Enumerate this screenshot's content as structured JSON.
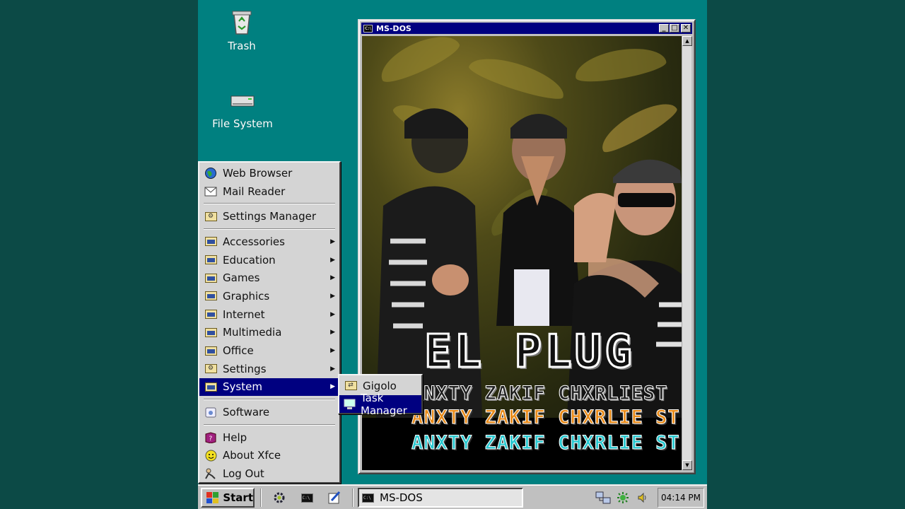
{
  "desktop": {
    "icons": [
      {
        "label": "Trash",
        "icon": "recycle-bin-icon"
      },
      {
        "label": "File System",
        "icon": "drive-icon"
      }
    ]
  },
  "window": {
    "title": "MS-DOS",
    "icon": "cmd-icon",
    "buttons": {
      "minimize": "_",
      "maximize": "□",
      "close": "✕"
    }
  },
  "artwork": {
    "title": "EL PLUG",
    "artists_lines": [
      "ANXTY ZAKIF CHXRLIEST",
      "ANXTY ZAKIF CHXRLIE ST",
      "ANXTY ZAKIF CHXRLIE ST"
    ]
  },
  "start_menu": {
    "items": [
      {
        "label": "Web Browser",
        "icon": "globe-icon"
      },
      {
        "label": "Mail Reader",
        "icon": "envelope-icon"
      },
      {
        "label": "Settings Manager",
        "icon": "settings-folder-icon"
      },
      {
        "label": "Accessories",
        "icon": "folder-icon"
      },
      {
        "label": "Education",
        "icon": "folder-icon"
      },
      {
        "label": "Games",
        "icon": "folder-icon"
      },
      {
        "label": "Graphics",
        "icon": "folder-icon"
      },
      {
        "label": "Internet",
        "icon": "folder-icon"
      },
      {
        "label": "Multimedia",
        "icon": "folder-icon"
      },
      {
        "label": "Office",
        "icon": "folder-icon"
      },
      {
        "label": "Settings",
        "icon": "settings-folder-icon"
      },
      {
        "label": "System",
        "icon": "folder-icon",
        "active": true
      },
      {
        "label": "Software",
        "icon": "software-icon"
      },
      {
        "label": "Help",
        "icon": "help-book-icon"
      },
      {
        "label": "About Xfce",
        "icon": "smiley-icon"
      },
      {
        "label": "Log Out",
        "icon": "logout-icon"
      }
    ]
  },
  "submenu": {
    "items": [
      {
        "label": "Gigolo",
        "icon": "gigolo-icon"
      },
      {
        "label": "Task Manager",
        "icon": "monitor-icon"
      }
    ]
  },
  "taskbar": {
    "start_label": "Start",
    "task_label": "MS-DOS",
    "clock": "04:14 PM"
  },
  "colors": {
    "desktop": "#008080",
    "titlebar": "#000080",
    "menu_highlight": "#000080",
    "outer_background": "#0c4a46"
  }
}
